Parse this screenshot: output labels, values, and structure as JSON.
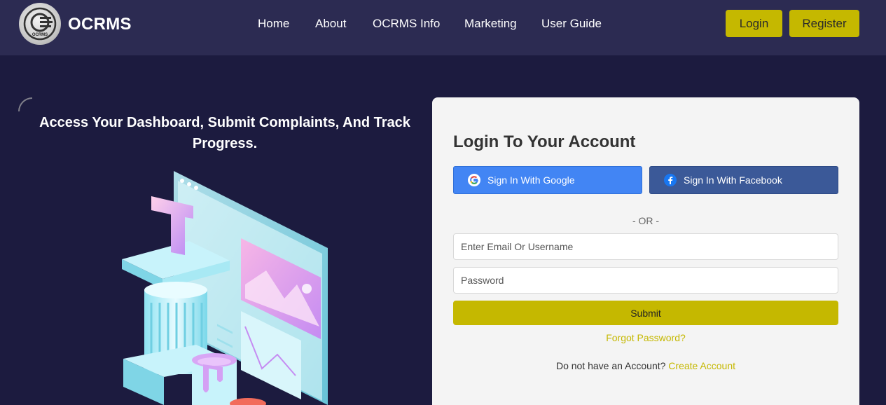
{
  "header": {
    "brand": "OCRMS",
    "logo_text": "OCRMS",
    "nav": [
      "Home",
      "About",
      "OCRMS Info",
      "Marketing",
      "User Guide"
    ],
    "login_label": "Login",
    "register_label": "Register"
  },
  "hero": {
    "headline": "Access Your Dashboard, Submit Complaints, And Track Progress."
  },
  "login_card": {
    "title": "Login To Your Account",
    "google_label": "Sign In With Google",
    "facebook_label": "Sign In With Facebook",
    "or_text": "- OR -",
    "email_placeholder": "Enter Email Or Username",
    "password_placeholder": "Password",
    "submit_label": "Submit",
    "forgot_label": "Forgot Password?",
    "no_account_text": "Do not have an Account?",
    "create_account_label": "Create Account"
  },
  "colors": {
    "page_bg": "#1c1b3f",
    "header_bg": "#2c2b52",
    "accent": "#c5b800",
    "google": "#4285f4",
    "facebook": "#3b5998"
  }
}
